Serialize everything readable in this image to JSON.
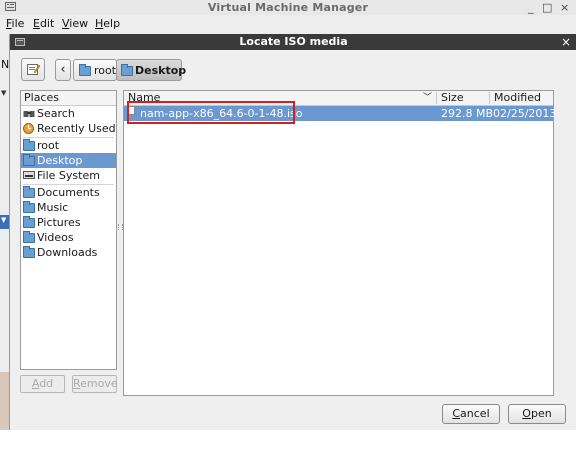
{
  "main_window": {
    "title": "Virtual Machine Manager",
    "minimize": "_",
    "maximize": "□",
    "close": "×",
    "menu": [
      {
        "key": "F",
        "rest": "ile"
      },
      {
        "key": "E",
        "rest": "dit"
      },
      {
        "key": "V",
        "rest": "iew"
      },
      {
        "key": "H",
        "rest": "elp"
      }
    ],
    "left_letter": "N"
  },
  "dialog": {
    "title": "Locate ISO media",
    "close": "×",
    "back": "‹",
    "breadcrumb": [
      "root",
      "Desktop"
    ],
    "places_header": "Places",
    "places": [
      {
        "label": "Search",
        "icon": "search-icon"
      },
      {
        "label": "Recently Used",
        "icon": "recent-icon"
      },
      {
        "label": "root",
        "icon": "folder-icon"
      },
      {
        "label": "Desktop",
        "icon": "folder-icon",
        "selected": true
      },
      {
        "label": "File System",
        "icon": "drive-icon"
      },
      {
        "label": "Documents",
        "icon": "folder-icon"
      },
      {
        "label": "Music",
        "icon": "folder-icon"
      },
      {
        "label": "Pictures",
        "icon": "folder-icon"
      },
      {
        "label": "Videos",
        "icon": "folder-icon"
      },
      {
        "label": "Downloads",
        "icon": "folder-icon"
      }
    ],
    "add_button": {
      "key": "A",
      "rest": "dd"
    },
    "remove_button": {
      "key": "R",
      "rest": "emove"
    },
    "columns": {
      "name": "Name",
      "size": "Size",
      "modified": "Modified"
    },
    "files": [
      {
        "name": "nam-app-x86_64.6-0-1-48.iso",
        "size": "292.8 MB",
        "modified": "02/25/2013",
        "selected": true
      }
    ],
    "cancel_button": {
      "key": "C",
      "rest": "ancel"
    },
    "open_button": {
      "key": "O",
      "rest": "pen"
    },
    "highlight_color": "#d02020",
    "selection_color": "#6b98cf"
  }
}
